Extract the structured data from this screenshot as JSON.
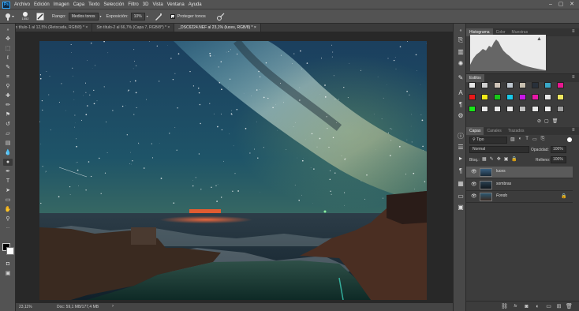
{
  "app": {
    "logo": "Ps"
  },
  "menu": [
    "Archivo",
    "Edición",
    "Imagen",
    "Capa",
    "Texto",
    "Selección",
    "Filtro",
    "3D",
    "Vista",
    "Ventana",
    "Ayuda"
  ],
  "window_controls": [
    "–",
    "▢",
    "✕"
  ],
  "options": {
    "brush_size": "1552",
    "range_label": "Rango:",
    "range_value": "Medios tonos",
    "exposure_label": "Exposición:",
    "exposure_value": "10%",
    "protect_label": "Proteger tonos"
  },
  "doc_tabs": [
    {
      "label": "Sin título-1 al 12,5% (Retocada, RGB/8) *",
      "close": "×"
    },
    {
      "label": "Sin título-2 al 66,7% (Capa 7, RGB/8*) *",
      "close": "×"
    },
    {
      "label": "_DSC6224.NEF al 23,1% (luces, RGB/8) *",
      "close": "×",
      "active": true
    }
  ],
  "status": {
    "zoom": "23,11%",
    "doc": "Doc: 59,1 MB/177,4 MB"
  },
  "histogram_panel": {
    "tabs": [
      "Histograma",
      "Color",
      "Muestras"
    ],
    "warning": "▲"
  },
  "styles_panel": {
    "title": "Estilos"
  },
  "layers_panel": {
    "tabs": [
      "Capas",
      "Canales",
      "Trazados"
    ],
    "filter_value": "Tipo",
    "blend_value": "Normal",
    "opacity_label": "Opacidad:",
    "opacity_value": "100%",
    "lock_label": "Bloq.:",
    "fill_label": "Relleno:",
    "fill_value": "100%",
    "layers": [
      {
        "name": "luces",
        "selected": true
      },
      {
        "name": "sombras",
        "selected": false
      },
      {
        "name": "Fondo",
        "selected": false,
        "italic": true,
        "locked": true
      }
    ],
    "footer_icons": [
      "link-icon",
      "fx-icon",
      "mask-icon",
      "adjustment-icon",
      "folder-icon",
      "new-layer-icon",
      "trash-icon"
    ]
  },
  "colors": {
    "swatches_row1": [
      "#e8e8e8",
      "#d0d0d0",
      "#cfc4b8",
      "#bfc8d0",
      "#c8c0b0",
      "#28303a",
      "#3aa8c8",
      "#e81890"
    ],
    "swatches_row2": [
      "#e81818",
      "#f0e818",
      "#18c818",
      "#18c8e8",
      "#c818e8",
      "#e818a8",
      "#e8e8e8",
      "#f0e860"
    ],
    "swatches_row3": [
      "#18e818",
      "#e8e8e8",
      "#e8e8e8",
      "#e8e8e8",
      "#c0c0c0",
      "#e8e8e8",
      "#f0f0f0",
      "#a0a0a0"
    ]
  }
}
